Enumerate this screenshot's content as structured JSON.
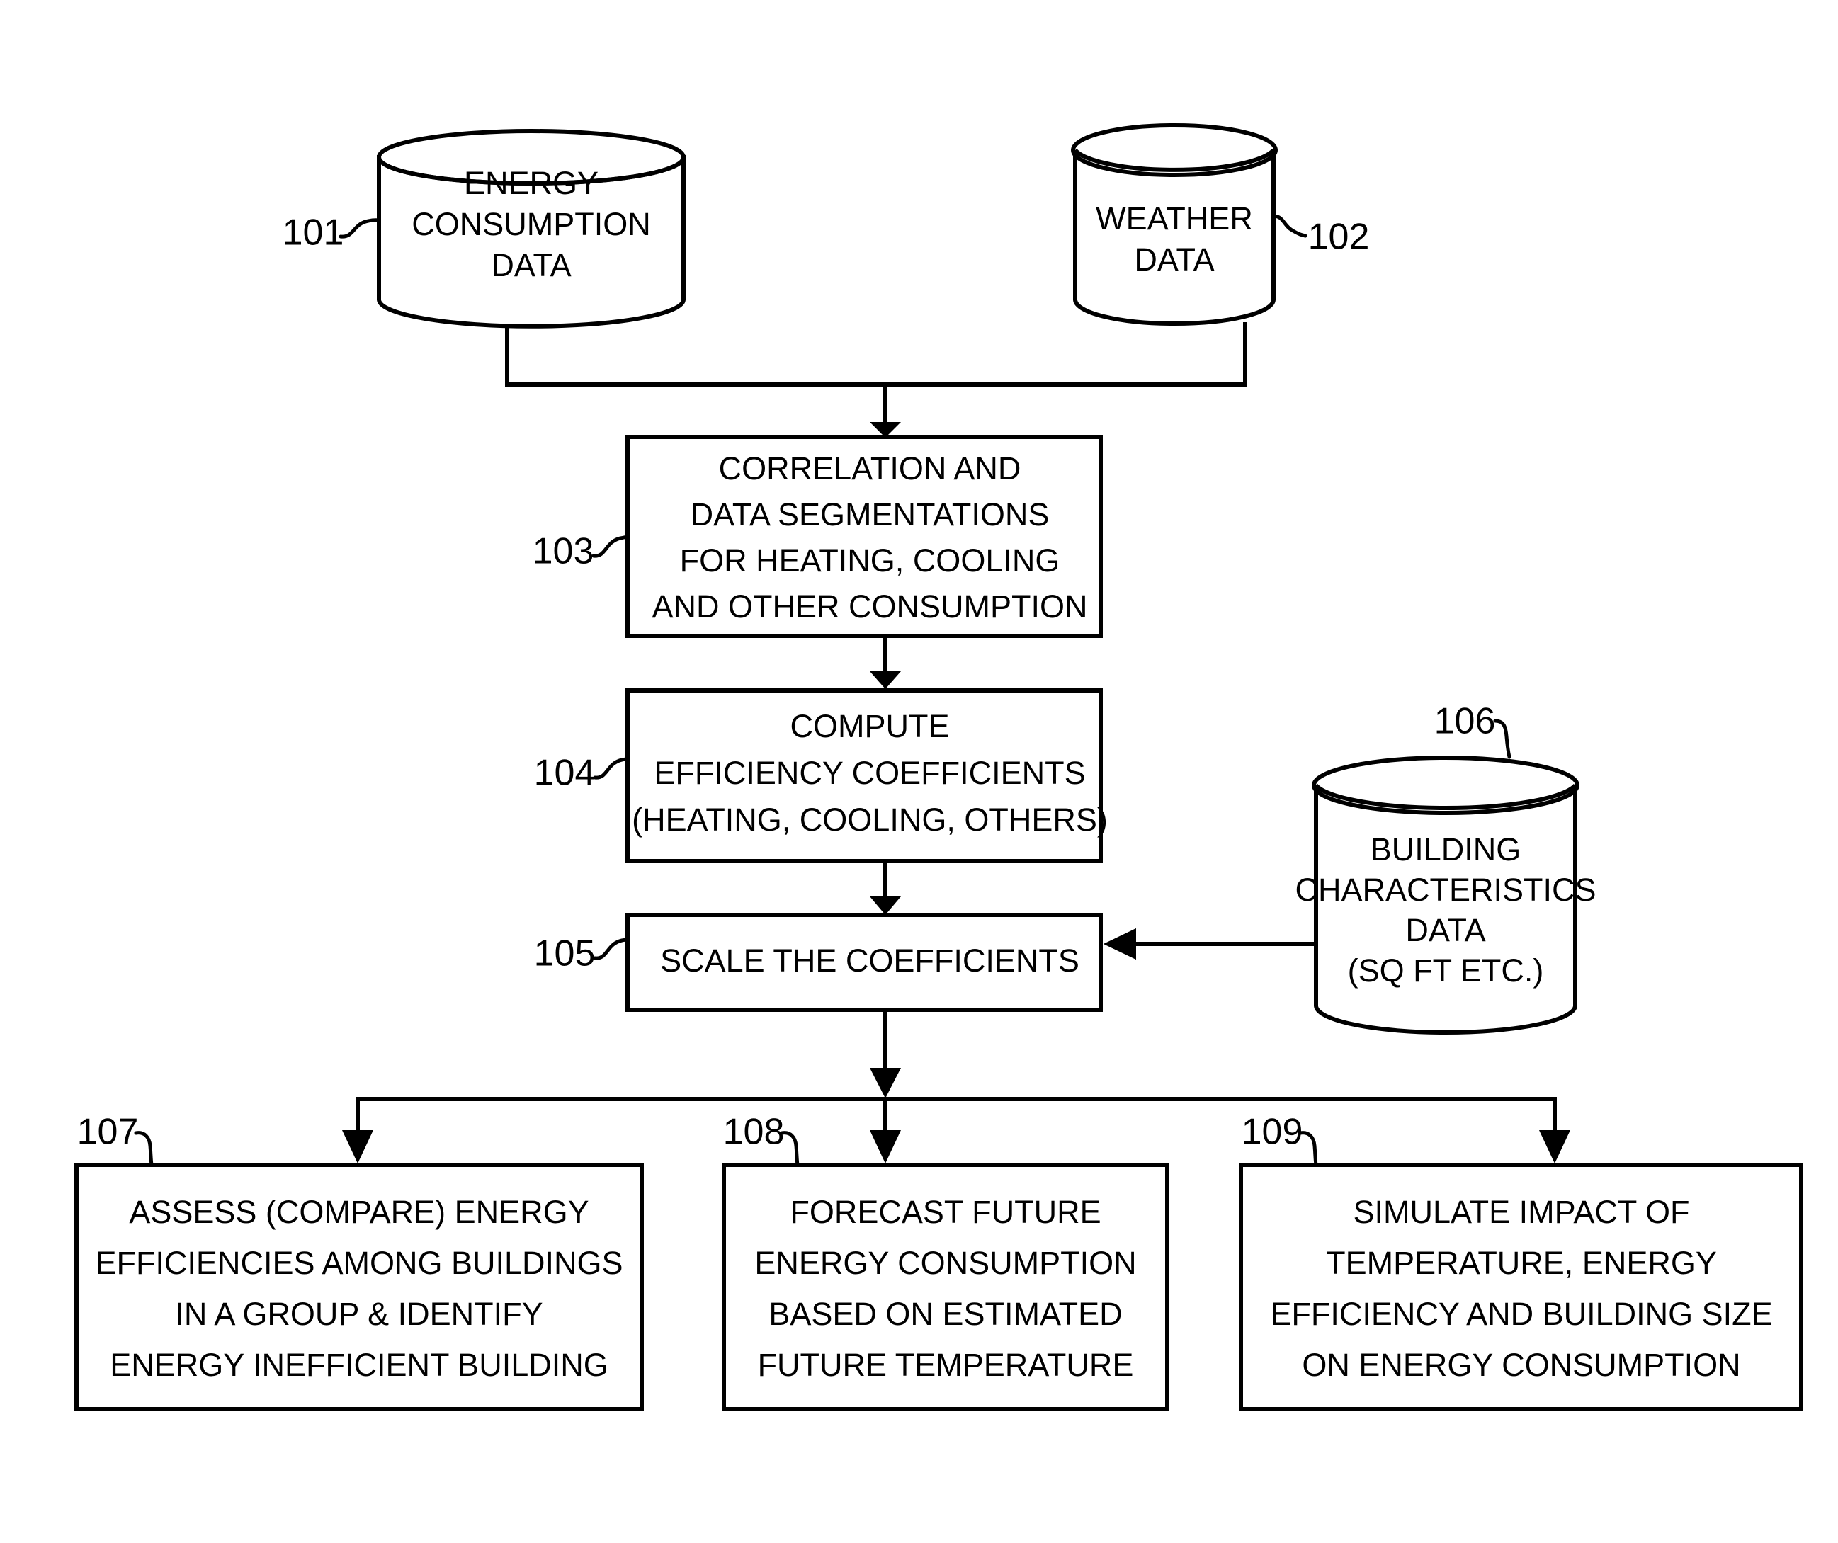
{
  "figure": {
    "type": "patent-flowchart",
    "title": "Building Energy Efficiency Analysis Process",
    "background_color": "#ffffff",
    "line_color": "#000000"
  },
  "nodes": {
    "energy_consumption_data": {
      "ref": "101",
      "shape": "cylinder",
      "lines": [
        "ENERGY",
        "CONSUMPTION",
        "DATA"
      ]
    },
    "weather_data": {
      "ref": "102",
      "shape": "cylinder",
      "lines": [
        "WEATHER",
        "DATA"
      ]
    },
    "correlation_segmentation": {
      "ref": "103",
      "shape": "rectangle",
      "lines": [
        "CORRELATION AND",
        "DATA SEGMENTATIONS",
        "FOR HEATING, COOLING",
        "AND OTHER CONSUMPTION"
      ]
    },
    "compute_efficiency": {
      "ref": "104",
      "shape": "rectangle",
      "lines": [
        "COMPUTE",
        "EFFICIENCY COEFFICIENTS",
        "(HEATING, COOLING, OTHERS)"
      ]
    },
    "scale_coefficients": {
      "ref": "105",
      "shape": "rectangle",
      "lines": [
        "SCALE THE COEFFICIENTS"
      ]
    },
    "building_characteristics": {
      "ref": "106",
      "shape": "cylinder",
      "lines": [
        "BUILDING",
        "CHARACTERISTICS",
        "DATA",
        "(SQ FT ETC.)"
      ]
    },
    "assess_efficiencies": {
      "ref": "107",
      "shape": "rectangle",
      "lines": [
        "ASSESS (COMPARE) ENERGY",
        "EFFICIENCIES AMONG BUILDINGS",
        "IN A GROUP & IDENTIFY",
        "ENERGY INEFFICIENT BUILDING"
      ]
    },
    "forecast_consumption": {
      "ref": "108",
      "shape": "rectangle",
      "lines": [
        "FORECAST FUTURE",
        "ENERGY CONSUMPTION",
        "BASED ON ESTIMATED",
        "FUTURE TEMPERATURE"
      ]
    },
    "simulate_impact": {
      "ref": "109",
      "shape": "rectangle",
      "lines": [
        "SIMULATE IMPACT OF",
        "TEMPERATURE, ENERGY",
        "EFFICIENCY AND BUILDING SIZE",
        "ON ENERGY CONSUMPTION"
      ]
    }
  }
}
